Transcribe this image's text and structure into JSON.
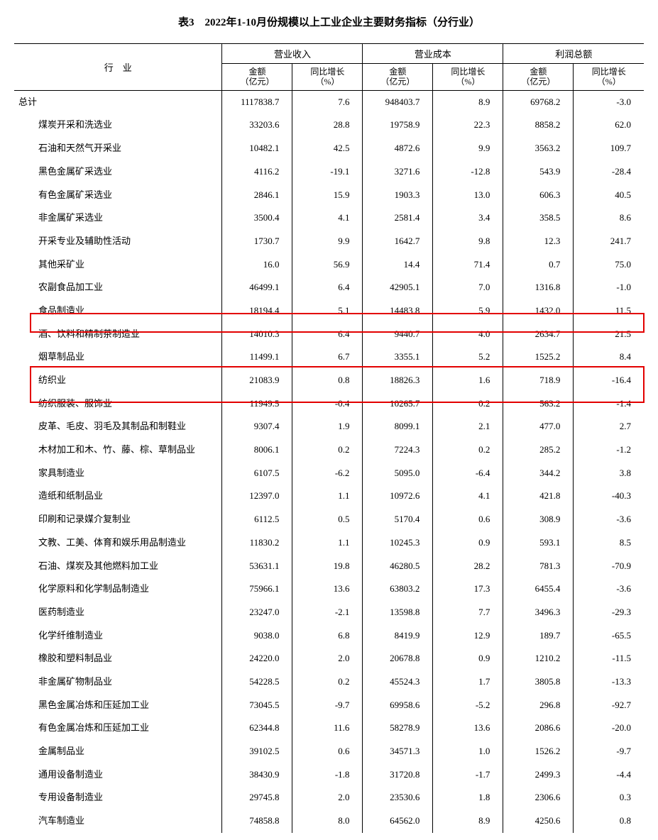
{
  "title": "表3　2022年1-10月份规模以上工业企业主要财务指标（分行业）",
  "header": {
    "industry": "行　业",
    "groups": [
      "营业收入",
      "营业成本",
      "利润总额"
    ],
    "sub_amount": "金额",
    "sub_amount_unit": "（亿元）",
    "sub_growth": "同比增长",
    "sub_growth_unit": "（%）"
  },
  "rows": [
    {
      "name": "总计",
      "indent": 0,
      "rev": "1117838.7",
      "revg": "7.6",
      "cost": "948403.7",
      "costg": "8.9",
      "prof": "69768.2",
      "profg": "-3.0"
    },
    {
      "name": "煤炭开采和洗选业",
      "indent": 1,
      "rev": "33203.6",
      "revg": "28.8",
      "cost": "19758.9",
      "costg": "22.3",
      "prof": "8858.2",
      "profg": "62.0"
    },
    {
      "name": "石油和天然气开采业",
      "indent": 1,
      "rev": "10482.1",
      "revg": "42.5",
      "cost": "4872.6",
      "costg": "9.9",
      "prof": "3563.2",
      "profg": "109.7"
    },
    {
      "name": "黑色金属矿采选业",
      "indent": 1,
      "rev": "4116.2",
      "revg": "-19.1",
      "cost": "3271.6",
      "costg": "-12.8",
      "prof": "543.9",
      "profg": "-28.4"
    },
    {
      "name": "有色金属矿采选业",
      "indent": 1,
      "rev": "2846.1",
      "revg": "15.9",
      "cost": "1903.3",
      "costg": "13.0",
      "prof": "606.3",
      "profg": "40.5"
    },
    {
      "name": "非金属矿采选业",
      "indent": 1,
      "rev": "3500.4",
      "revg": "4.1",
      "cost": "2581.4",
      "costg": "3.4",
      "prof": "358.5",
      "profg": "8.6"
    },
    {
      "name": "开采专业及辅助性活动",
      "indent": 1,
      "rev": "1730.7",
      "revg": "9.9",
      "cost": "1642.7",
      "costg": "9.8",
      "prof": "12.3",
      "profg": "241.7"
    },
    {
      "name": "其他采矿业",
      "indent": 1,
      "rev": "16.0",
      "revg": "56.9",
      "cost": "14.4",
      "costg": "71.4",
      "prof": "0.7",
      "profg": "75.0"
    },
    {
      "name": "农副食品加工业",
      "indent": 1,
      "rev": "46499.1",
      "revg": "6.4",
      "cost": "42905.1",
      "costg": "7.0",
      "prof": "1316.8",
      "profg": "-1.0"
    },
    {
      "name": "食品制造业",
      "indent": 1,
      "rev": "18194.4",
      "revg": "5.1",
      "cost": "14483.8",
      "costg": "5.9",
      "prof": "1432.0",
      "profg": "11.5"
    },
    {
      "name": "酒、饮料和精制茶制造业",
      "indent": 1,
      "rev": "14010.3",
      "revg": "6.4",
      "cost": "9440.7",
      "costg": "4.0",
      "prof": "2634.7",
      "profg": "21.5"
    },
    {
      "name": "烟草制品业",
      "indent": 1,
      "rev": "11499.1",
      "revg": "6.7",
      "cost": "3355.1",
      "costg": "5.2",
      "prof": "1525.2",
      "profg": "8.4"
    },
    {
      "name": "纺织业",
      "indent": 1,
      "rev": "21083.9",
      "revg": "0.8",
      "cost": "18826.3",
      "costg": "1.6",
      "prof": "718.9",
      "profg": "-16.4"
    },
    {
      "name": "纺织服装、服饰业",
      "indent": 1,
      "rev": "11949.5",
      "revg": "-0.4",
      "cost": "10265.7",
      "costg": "0.2",
      "prof": "563.2",
      "profg": "-1.4"
    },
    {
      "name": "皮革、毛皮、羽毛及其制品和制鞋业",
      "indent": 1,
      "rev": "9307.4",
      "revg": "1.9",
      "cost": "8099.1",
      "costg": "2.1",
      "prof": "477.0",
      "profg": "2.7"
    },
    {
      "name": "木材加工和木、竹、藤、棕、草制品业",
      "indent": 1,
      "rev": "8006.1",
      "revg": "0.2",
      "cost": "7224.3",
      "costg": "0.2",
      "prof": "285.2",
      "profg": "-1.2"
    },
    {
      "name": "家具制造业",
      "indent": 1,
      "rev": "6107.5",
      "revg": "-6.2",
      "cost": "5095.0",
      "costg": "-6.4",
      "prof": "344.2",
      "profg": "3.8"
    },
    {
      "name": "造纸和纸制品业",
      "indent": 1,
      "rev": "12397.0",
      "revg": "1.1",
      "cost": "10972.6",
      "costg": "4.1",
      "prof": "421.8",
      "profg": "-40.3"
    },
    {
      "name": "印刷和记录媒介复制业",
      "indent": 1,
      "rev": "6112.5",
      "revg": "0.5",
      "cost": "5170.4",
      "costg": "0.6",
      "prof": "308.9",
      "profg": "-3.6"
    },
    {
      "name": "文教、工美、体育和娱乐用品制造业",
      "indent": 1,
      "rev": "11830.2",
      "revg": "1.1",
      "cost": "10245.3",
      "costg": "0.9",
      "prof": "593.1",
      "profg": "8.5"
    },
    {
      "name": "石油、煤炭及其他燃料加工业",
      "indent": 1,
      "rev": "53631.1",
      "revg": "19.8",
      "cost": "46280.5",
      "costg": "28.2",
      "prof": "781.3",
      "profg": "-70.9"
    },
    {
      "name": "化学原料和化学制品制造业",
      "indent": 1,
      "rev": "75966.1",
      "revg": "13.6",
      "cost": "63803.2",
      "costg": "17.3",
      "prof": "6455.4",
      "profg": "-3.6"
    },
    {
      "name": "医药制造业",
      "indent": 1,
      "rev": "23247.0",
      "revg": "-2.1",
      "cost": "13598.8",
      "costg": "7.7",
      "prof": "3496.3",
      "profg": "-29.3"
    },
    {
      "name": "化学纤维制造业",
      "indent": 1,
      "rev": "9038.0",
      "revg": "6.8",
      "cost": "8419.9",
      "costg": "12.9",
      "prof": "189.7",
      "profg": "-65.5"
    },
    {
      "name": "橡胶和塑料制品业",
      "indent": 1,
      "rev": "24220.0",
      "revg": "2.0",
      "cost": "20678.8",
      "costg": "0.9",
      "prof": "1210.2",
      "profg": "-11.5"
    },
    {
      "name": "非金属矿物制品业",
      "indent": 1,
      "rev": "54228.5",
      "revg": "0.2",
      "cost": "45524.3",
      "costg": "1.7",
      "prof": "3805.8",
      "profg": "-13.3"
    },
    {
      "name": "黑色金属冶炼和压延加工业",
      "indent": 1,
      "rev": "73045.5",
      "revg": "-9.7",
      "cost": "69958.6",
      "costg": "-5.2",
      "prof": "296.8",
      "profg": "-92.7"
    },
    {
      "name": "有色金属冶炼和压延加工业",
      "indent": 1,
      "rev": "62344.8",
      "revg": "11.6",
      "cost": "58278.9",
      "costg": "13.6",
      "prof": "2086.6",
      "profg": "-20.0"
    },
    {
      "name": "金属制品业",
      "indent": 1,
      "rev": "39102.5",
      "revg": "0.6",
      "cost": "34571.3",
      "costg": "1.0",
      "prof": "1526.2",
      "profg": "-9.7"
    },
    {
      "name": "通用设备制造业",
      "indent": 1,
      "rev": "38430.9",
      "revg": "-1.8",
      "cost": "31720.8",
      "costg": "-1.7",
      "prof": "2499.3",
      "profg": "-4.4"
    },
    {
      "name": "专用设备制造业",
      "indent": 1,
      "rev": "29745.8",
      "revg": "2.0",
      "cost": "23530.6",
      "costg": "1.8",
      "prof": "2306.6",
      "profg": "0.3"
    },
    {
      "name": "汽车制造业",
      "indent": 1,
      "rev": "74858.8",
      "revg": "8.0",
      "cost": "64562.0",
      "costg": "8.9",
      "prof": "4250.6",
      "profg": "0.8"
    }
  ]
}
